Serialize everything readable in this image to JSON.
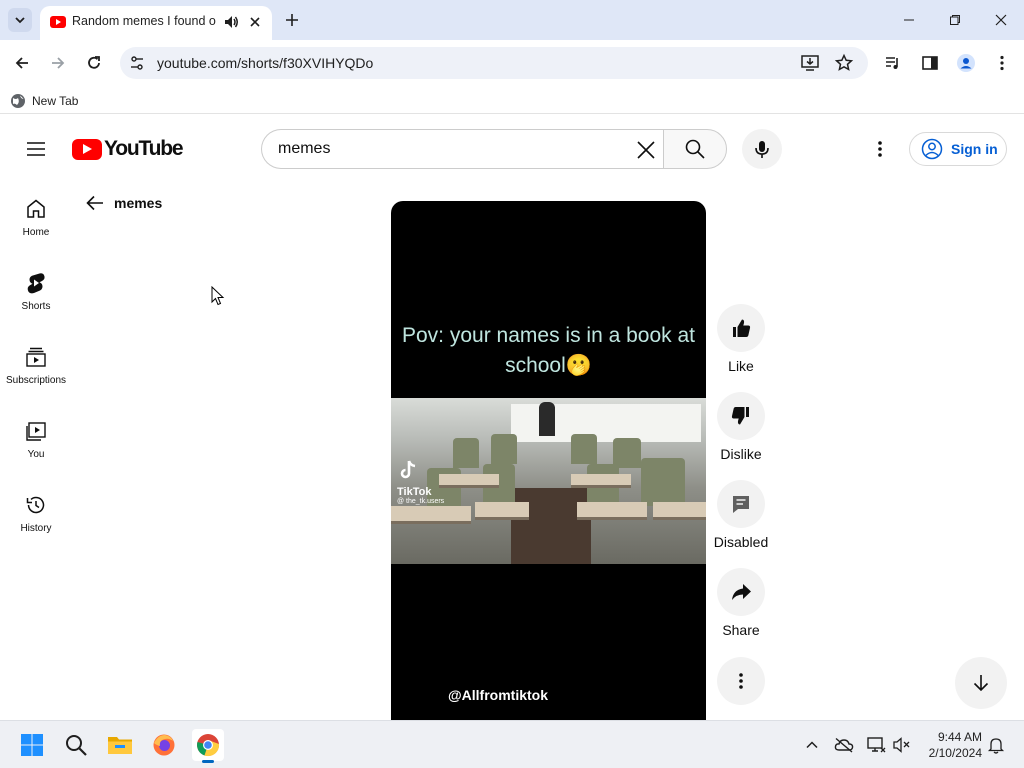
{
  "browser": {
    "tab_title": "Random memes I found on",
    "url": "youtube.com/shorts/f30XVIHYQDo",
    "bookmark": "New Tab"
  },
  "youtube": {
    "logo_text": "YouTube",
    "search_value": "memes",
    "sign_in_label": "Sign in",
    "guide": [
      {
        "label": "Home",
        "icon": "home-icon"
      },
      {
        "label": "Shorts",
        "icon": "shorts-icon"
      },
      {
        "label": "Subscriptions",
        "icon": "subscriptions-icon"
      },
      {
        "label": "You",
        "icon": "library-icon"
      },
      {
        "label": "History",
        "icon": "history-icon"
      }
    ],
    "back_label": "memes",
    "short": {
      "caption": "Pov: your names is in a book at school🫢",
      "watermark_name": "TikTok",
      "watermark_user": "@ the_tk.users",
      "channel": "@Allfromtiktok"
    },
    "actions": [
      {
        "label": "Like",
        "icon": "thumb-up-icon"
      },
      {
        "label": "Dislike",
        "icon": "thumb-down-icon"
      },
      {
        "label": "Disabled",
        "icon": "comment-icon"
      },
      {
        "label": "Share",
        "icon": "share-icon"
      }
    ]
  },
  "taskbar": {
    "time": "9:44 AM",
    "date": "2/10/2024"
  }
}
